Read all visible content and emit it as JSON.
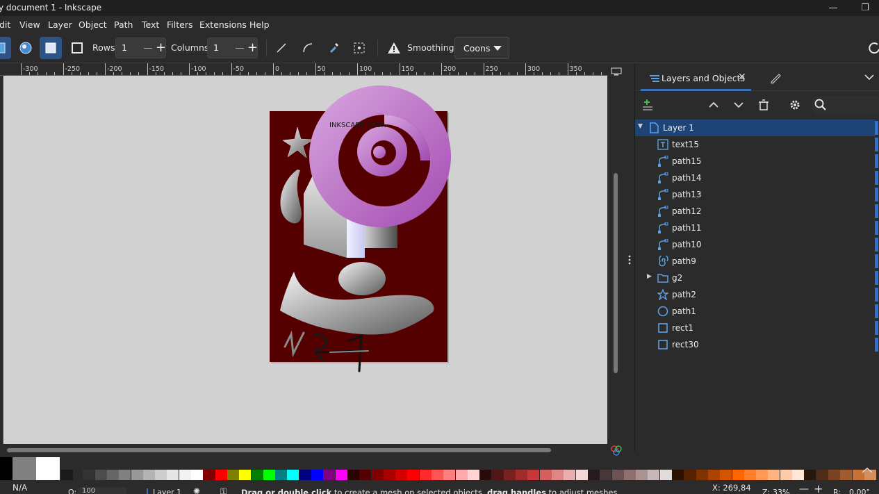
{
  "window": {
    "title": "y document 1 - Inkscape",
    "minimize": "—",
    "maximize": "❐"
  },
  "menu": [
    "dit",
    "View",
    "Layer",
    "Object",
    "Path",
    "Text",
    "Filters",
    "Extensions",
    "Help"
  ],
  "toolbar": {
    "rows_label": "Rows:",
    "rows_value": "1",
    "columns_label": "Columns:",
    "columns_value": "1",
    "smoothing_label": "Smoothing:",
    "smoothing_value": "Coons"
  },
  "ruler": {
    "ticks": [
      "-300",
      "-250",
      "-200",
      "-150",
      "-100",
      "-50",
      "0",
      "50",
      "100",
      "150",
      "200",
      "250",
      "300",
      "350"
    ]
  },
  "canvas": {
    "page_text": "INKSCAPE COBA",
    "page_color": "#550000"
  },
  "dock": {
    "tab_layers": "Layers and Objects",
    "tree": [
      {
        "label": "Layer 1",
        "icon": "layer-icon",
        "selected": true,
        "expanded": true
      },
      {
        "label": "text15",
        "icon": "text-icon"
      },
      {
        "label": "path15",
        "icon": "path-icon"
      },
      {
        "label": "path14",
        "icon": "path-icon"
      },
      {
        "label": "path13",
        "icon": "path-icon"
      },
      {
        "label": "path12",
        "icon": "path-icon"
      },
      {
        "label": "path11",
        "icon": "path-icon"
      },
      {
        "label": "path10",
        "icon": "path-icon"
      },
      {
        "label": "path9",
        "icon": "spiral-icon"
      },
      {
        "label": "g2",
        "icon": "group-icon",
        "collapsed": true
      },
      {
        "label": "path2",
        "icon": "star-icon"
      },
      {
        "label": "path1",
        "icon": "circle-icon"
      },
      {
        "label": "rect1",
        "icon": "rect-icon"
      },
      {
        "label": "rect30",
        "icon": "rect-icon"
      }
    ]
  },
  "palette": {
    "colors": [
      "#000000",
      "#808080",
      "#ffffff",
      "#1a1a1a",
      "#333333",
      "#4d4d4d",
      "#666666",
      "#808080",
      "#999999",
      "#b3b3b3",
      "#cccccc",
      "#e6e6e6",
      "#f2f2f2",
      "#ffffff",
      "#800000",
      "#ff0000",
      "#808000",
      "#ffff00",
      "#008000",
      "#00ff00",
      "#008080",
      "#00ffff",
      "#000080",
      "#0000ff",
      "#800080",
      "#ff00ff",
      "#2b0000",
      "#550000",
      "#800000",
      "#aa0000",
      "#d40000",
      "#ff0000",
      "#ff2a2a",
      "#ff5555",
      "#ff8080",
      "#ffaaaa",
      "#ffd5d5",
      "#280b0b",
      "#501616",
      "#782121",
      "#a02c2c",
      "#c83737",
      "#d35f5f",
      "#de8787",
      "#e9afaf",
      "#f4d7d7",
      "#241c1c",
      "#483737",
      "#6c5353",
      "#916f6f",
      "#ac9393",
      "#c8b7b7",
      "#e3dbdb",
      "#2b1100",
      "#552200",
      "#803300",
      "#aa4400",
      "#d45500",
      "#ff6600",
      "#ff7f2a",
      "#ff9955",
      "#ffb380",
      "#ffccaa",
      "#ffe6d5",
      "#28170b",
      "#502d16",
      "#784421",
      "#a05a2c",
      "#c87137",
      "#d38d5f"
    ]
  },
  "status": {
    "fill_label": "N/A",
    "opacity_label": "O:",
    "opacity_value": "100",
    "layer": "Layer 1",
    "message_bold": "Drag or double click",
    "message": " to create a mesh on selected objects, ",
    "message_bold2": "drag handles",
    "message_end": " to adjust meshes.",
    "cursor_x": "X: 269,84",
    "zoom_label": "Z:",
    "zoom_value": "33%",
    "rotate_label": "R:",
    "rotate_value": "0,00°"
  }
}
